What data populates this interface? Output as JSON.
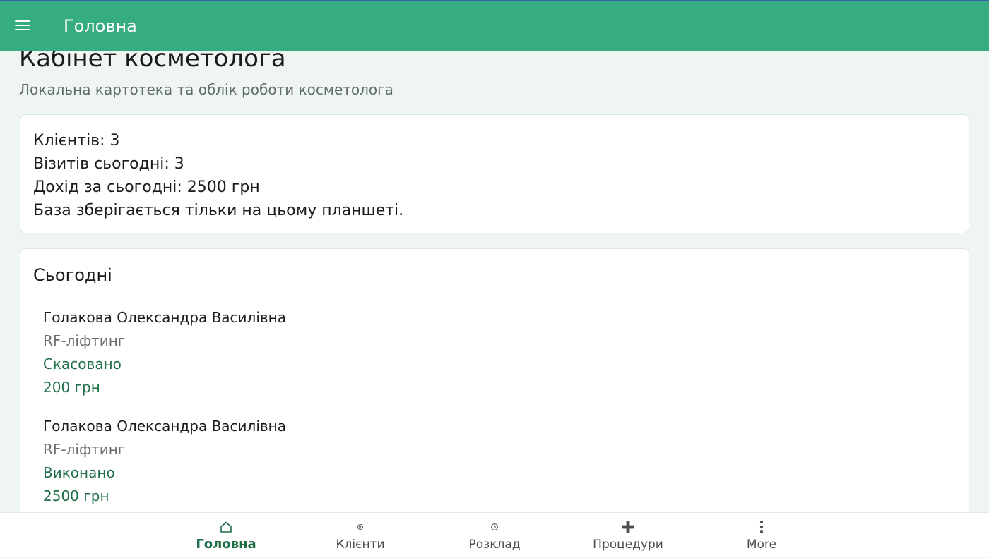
{
  "appbar": {
    "title": "Головна"
  },
  "page": {
    "title": "Кабінет косметолога",
    "subtitle": "Локальна картотека та облік роботи косметолога"
  },
  "stats": {
    "clients": "Клієнтів: 3",
    "visits_today": "Візитів сьогодні: 3",
    "income_today": "Дохід за сьогодні: 2500 грн",
    "storage_note": "База зберігається тільки на цьому планшеті."
  },
  "today": {
    "title": "Сьогодні",
    "visits": [
      {
        "client": "Голакова Олександра Василівна",
        "procedure": "RF-ліфтинг",
        "status": "Скасовано",
        "price": "200 грн"
      },
      {
        "client": "Голакова Олександра Василівна",
        "procedure": "RF-ліфтинг",
        "status": "Виконано",
        "price": "2500 грн"
      }
    ]
  },
  "bottom_nav": {
    "items": [
      {
        "label": "Головна",
        "icon": "home-icon",
        "active": true
      },
      {
        "label": "Клієнти",
        "icon": "clients-icon",
        "active": false
      },
      {
        "label": "Розклад",
        "icon": "schedule-icon",
        "active": false
      },
      {
        "label": "Процедури",
        "icon": "plus-icon",
        "active": false
      },
      {
        "label": "More",
        "icon": "more-vertical-icon",
        "active": false
      }
    ]
  },
  "colors": {
    "appbar": "#35ad80",
    "accent_text": "#1f6e48",
    "background": "#eff6f2"
  }
}
